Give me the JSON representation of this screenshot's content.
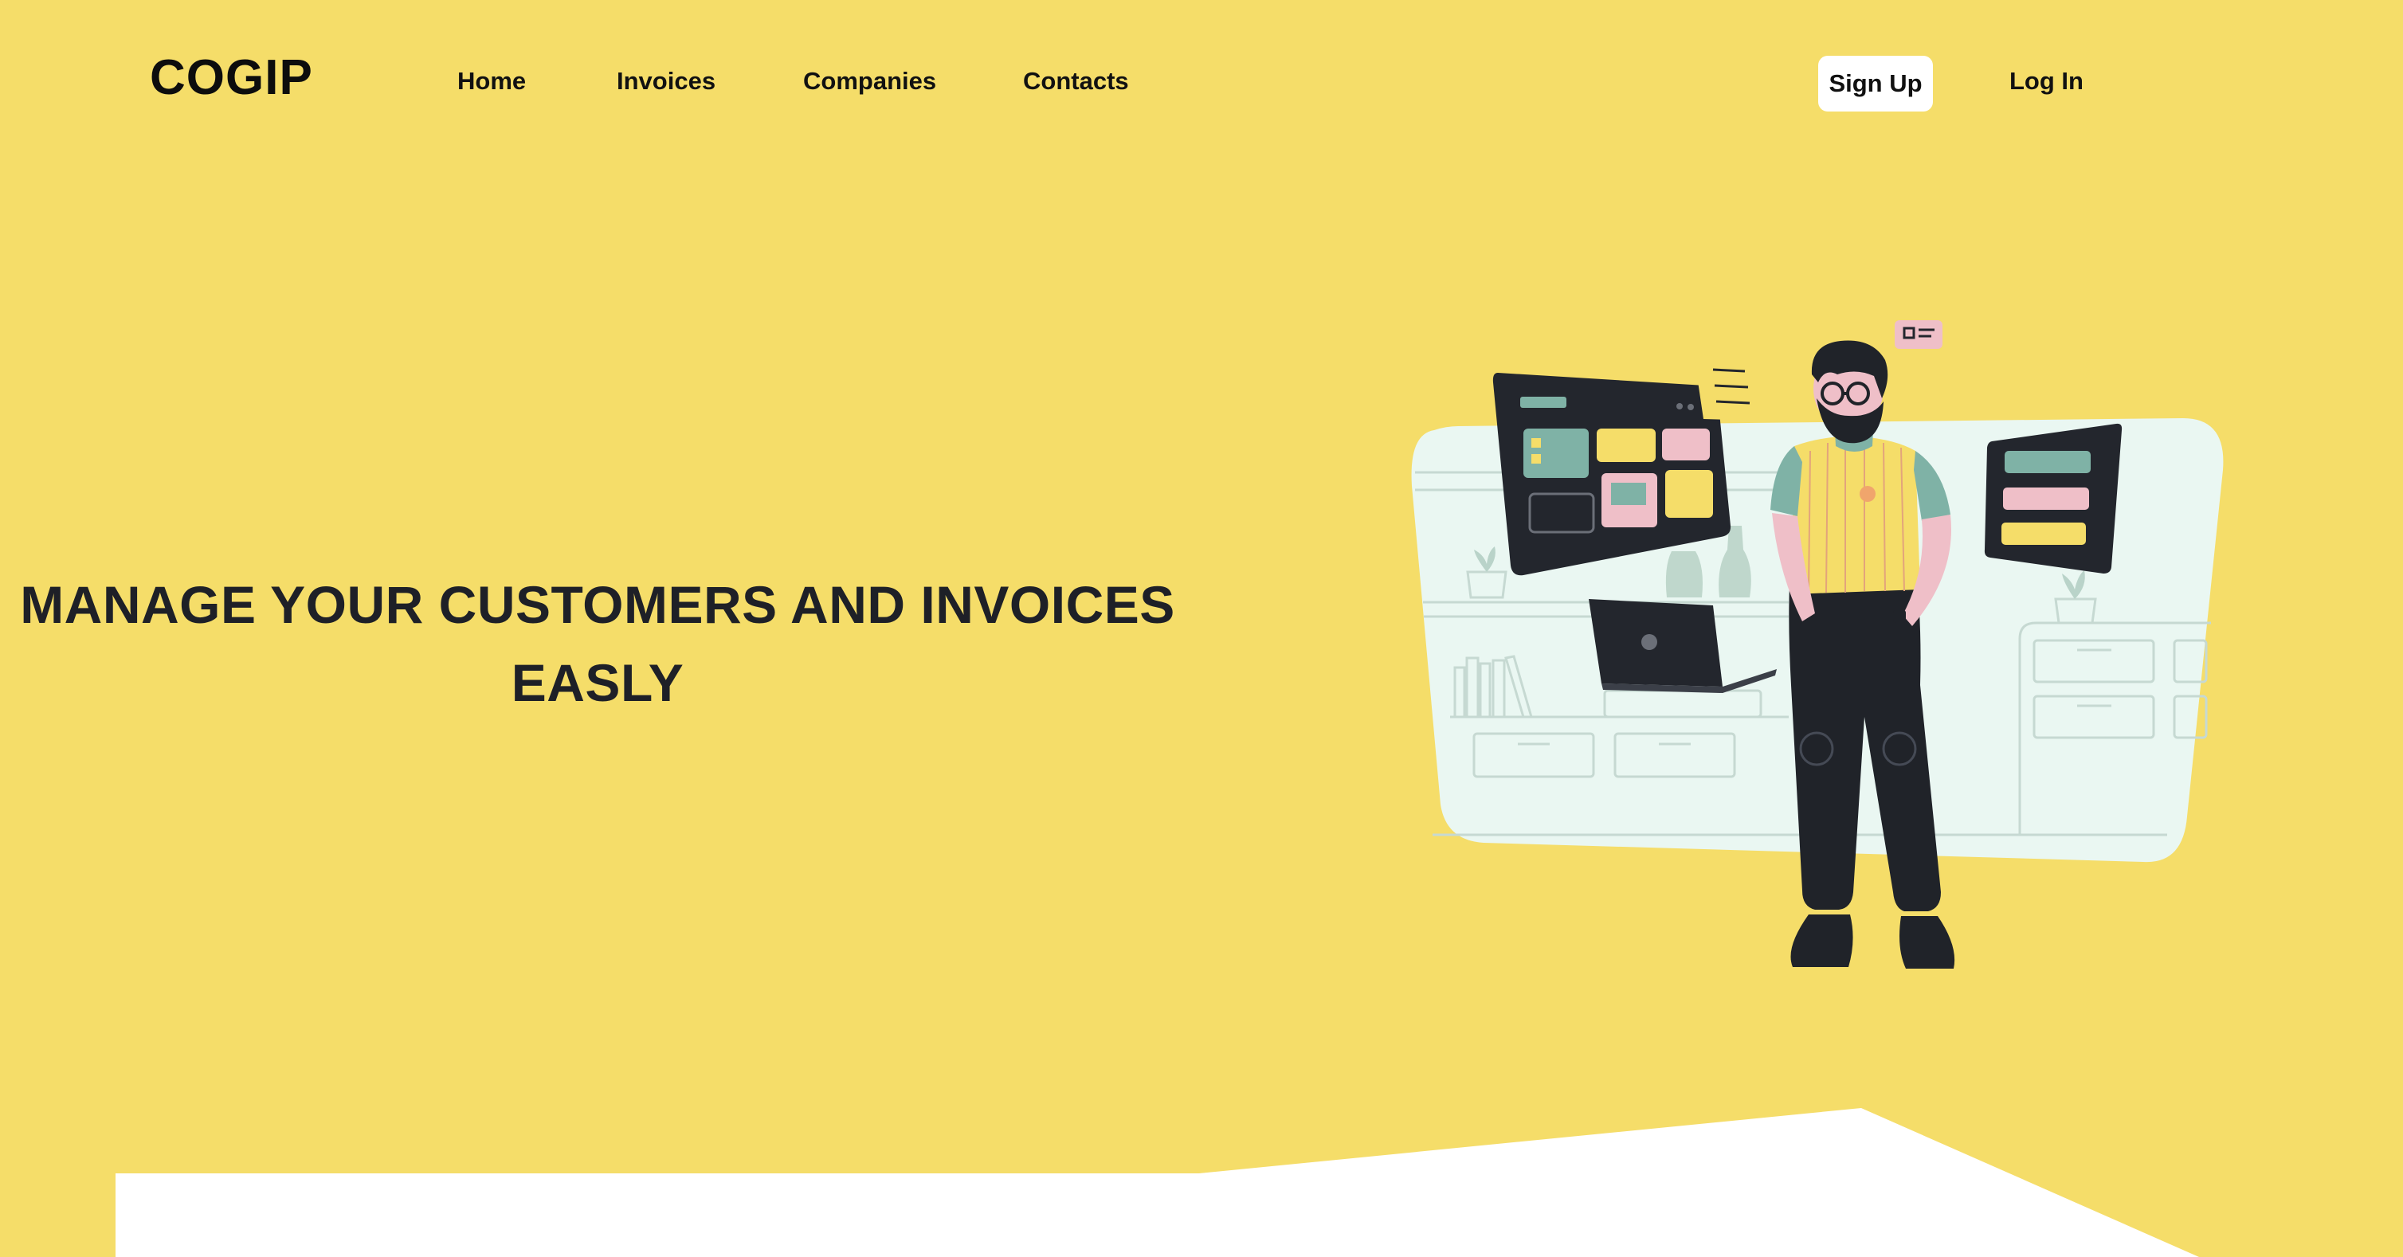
{
  "brand": {
    "logo": "COGIP"
  },
  "nav": {
    "items": [
      {
        "label": "Home"
      },
      {
        "label": "Invoices"
      },
      {
        "label": "Companies"
      },
      {
        "label": "Contacts"
      }
    ]
  },
  "auth": {
    "signup_label": "Sign Up",
    "login_label": "Log In"
  },
  "hero": {
    "title": "MANAGE YOUR CUSTOMERS AND INVOICES EASLY",
    "illustration": "person-with-dashboards-illustration"
  },
  "colors": {
    "background": "#f5dd69",
    "accent_teal": "#7fb2a6",
    "accent_pink": "#efbfc8",
    "dark": "#202329",
    "panel": "#eaf7f2"
  }
}
